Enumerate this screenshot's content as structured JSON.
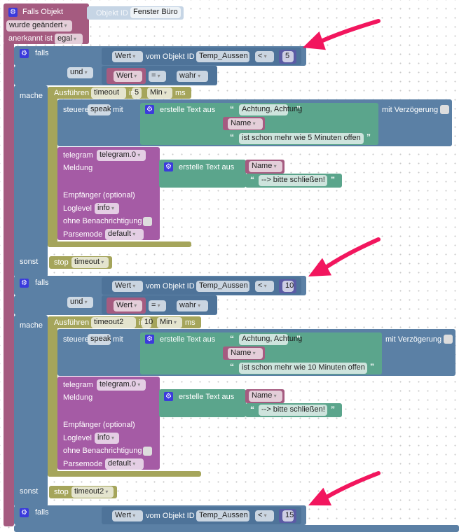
{
  "colors": {
    "event": "#a55b80",
    "logic": "#5b80a5",
    "timer": "#a5a55b",
    "text": "#5ba58c",
    "telegram": "#a55ba5",
    "value": "#a55b80",
    "number": "#5b5ba5",
    "objectid": "#c6d5e5",
    "arrow": "#f2165e"
  },
  "event": {
    "title": "Falls Objekt",
    "objid_label": "Objekt ID",
    "objid_value": "Fenster Büro",
    "trigger": "wurde geändert",
    "ack_label": "anerkannt ist",
    "ack_value": "egal"
  },
  "sections": [
    {
      "if": "falls",
      "value_dd": "Wert",
      "from_obj": "vom Objekt ID",
      "obj": "Temp_Aussen",
      "op": "<",
      "num": "5",
      "and": "und",
      "wert2": "Wert",
      "eq": "=",
      "bool": "wahr",
      "do": "mache",
      "exec": "Ausführen",
      "timer": "timeout",
      "in": "in",
      "delay": "5",
      "unit": "Min",
      "ms": "ms",
      "control": "steuere",
      "target": "speak",
      "with": "mit",
      "make_text": "erstelle Text aus",
      "t1": "Achtung, Achtung",
      "name": "Name",
      "t2": "ist schon mehr wie 5 Minuten offen",
      "with_delay": "mit Verzögerung",
      "telegram": "telegram",
      "instance": "telegram.0",
      "message": "Meldung",
      "tg_make_text": "erstelle Text aus",
      "tg_name": "Name",
      "tg_text": "--> bitte schließen!",
      "recipient": "Empfänger (optional)",
      "loglevel": "Loglevel",
      "loglevel_value": "info",
      "silent": "ohne Benachrichtigung",
      "parsemode": "Parsemode",
      "parsemode_value": "default",
      "else": "sonst",
      "stop": "stop",
      "stop_timer": "timeout"
    },
    {
      "if": "falls",
      "value_dd": "Wert",
      "from_obj": "vom Objekt ID",
      "obj": "Temp_Aussen",
      "op": "<",
      "num": "10",
      "and": "und",
      "wert2": "Wert",
      "eq": "=",
      "bool": "wahr",
      "do": "mache",
      "exec": "Ausführen",
      "timer": "timeout2",
      "in": "in",
      "delay": "10",
      "unit": "Min",
      "ms": "ms",
      "control": "steuere",
      "target": "speak",
      "with": "mit",
      "make_text": "erstelle Text aus",
      "t1": "Achtung, Achtung",
      "name": "Name",
      "t2": "ist schon mehr wie 10 Minuten offen",
      "with_delay": "mit Verzögerung",
      "telegram": "telegram",
      "instance": "telegram.0",
      "message": "Meldung",
      "tg_make_text": "erstelle Text aus",
      "tg_name": "Name",
      "tg_text": "--> bitte schließen!",
      "recipient": "Empfänger (optional)",
      "loglevel": "Loglevel",
      "loglevel_value": "info",
      "silent": "ohne Benachrichtigung",
      "parsemode": "Parsemode",
      "parsemode_value": "default",
      "else": "sonst",
      "stop": "stop",
      "stop_timer": "timeout2"
    },
    {
      "if": "falls",
      "value_dd": "Wert",
      "from_obj": "vom Objekt ID",
      "obj": "Temp_Aussen",
      "op": "<",
      "num": "15"
    }
  ]
}
